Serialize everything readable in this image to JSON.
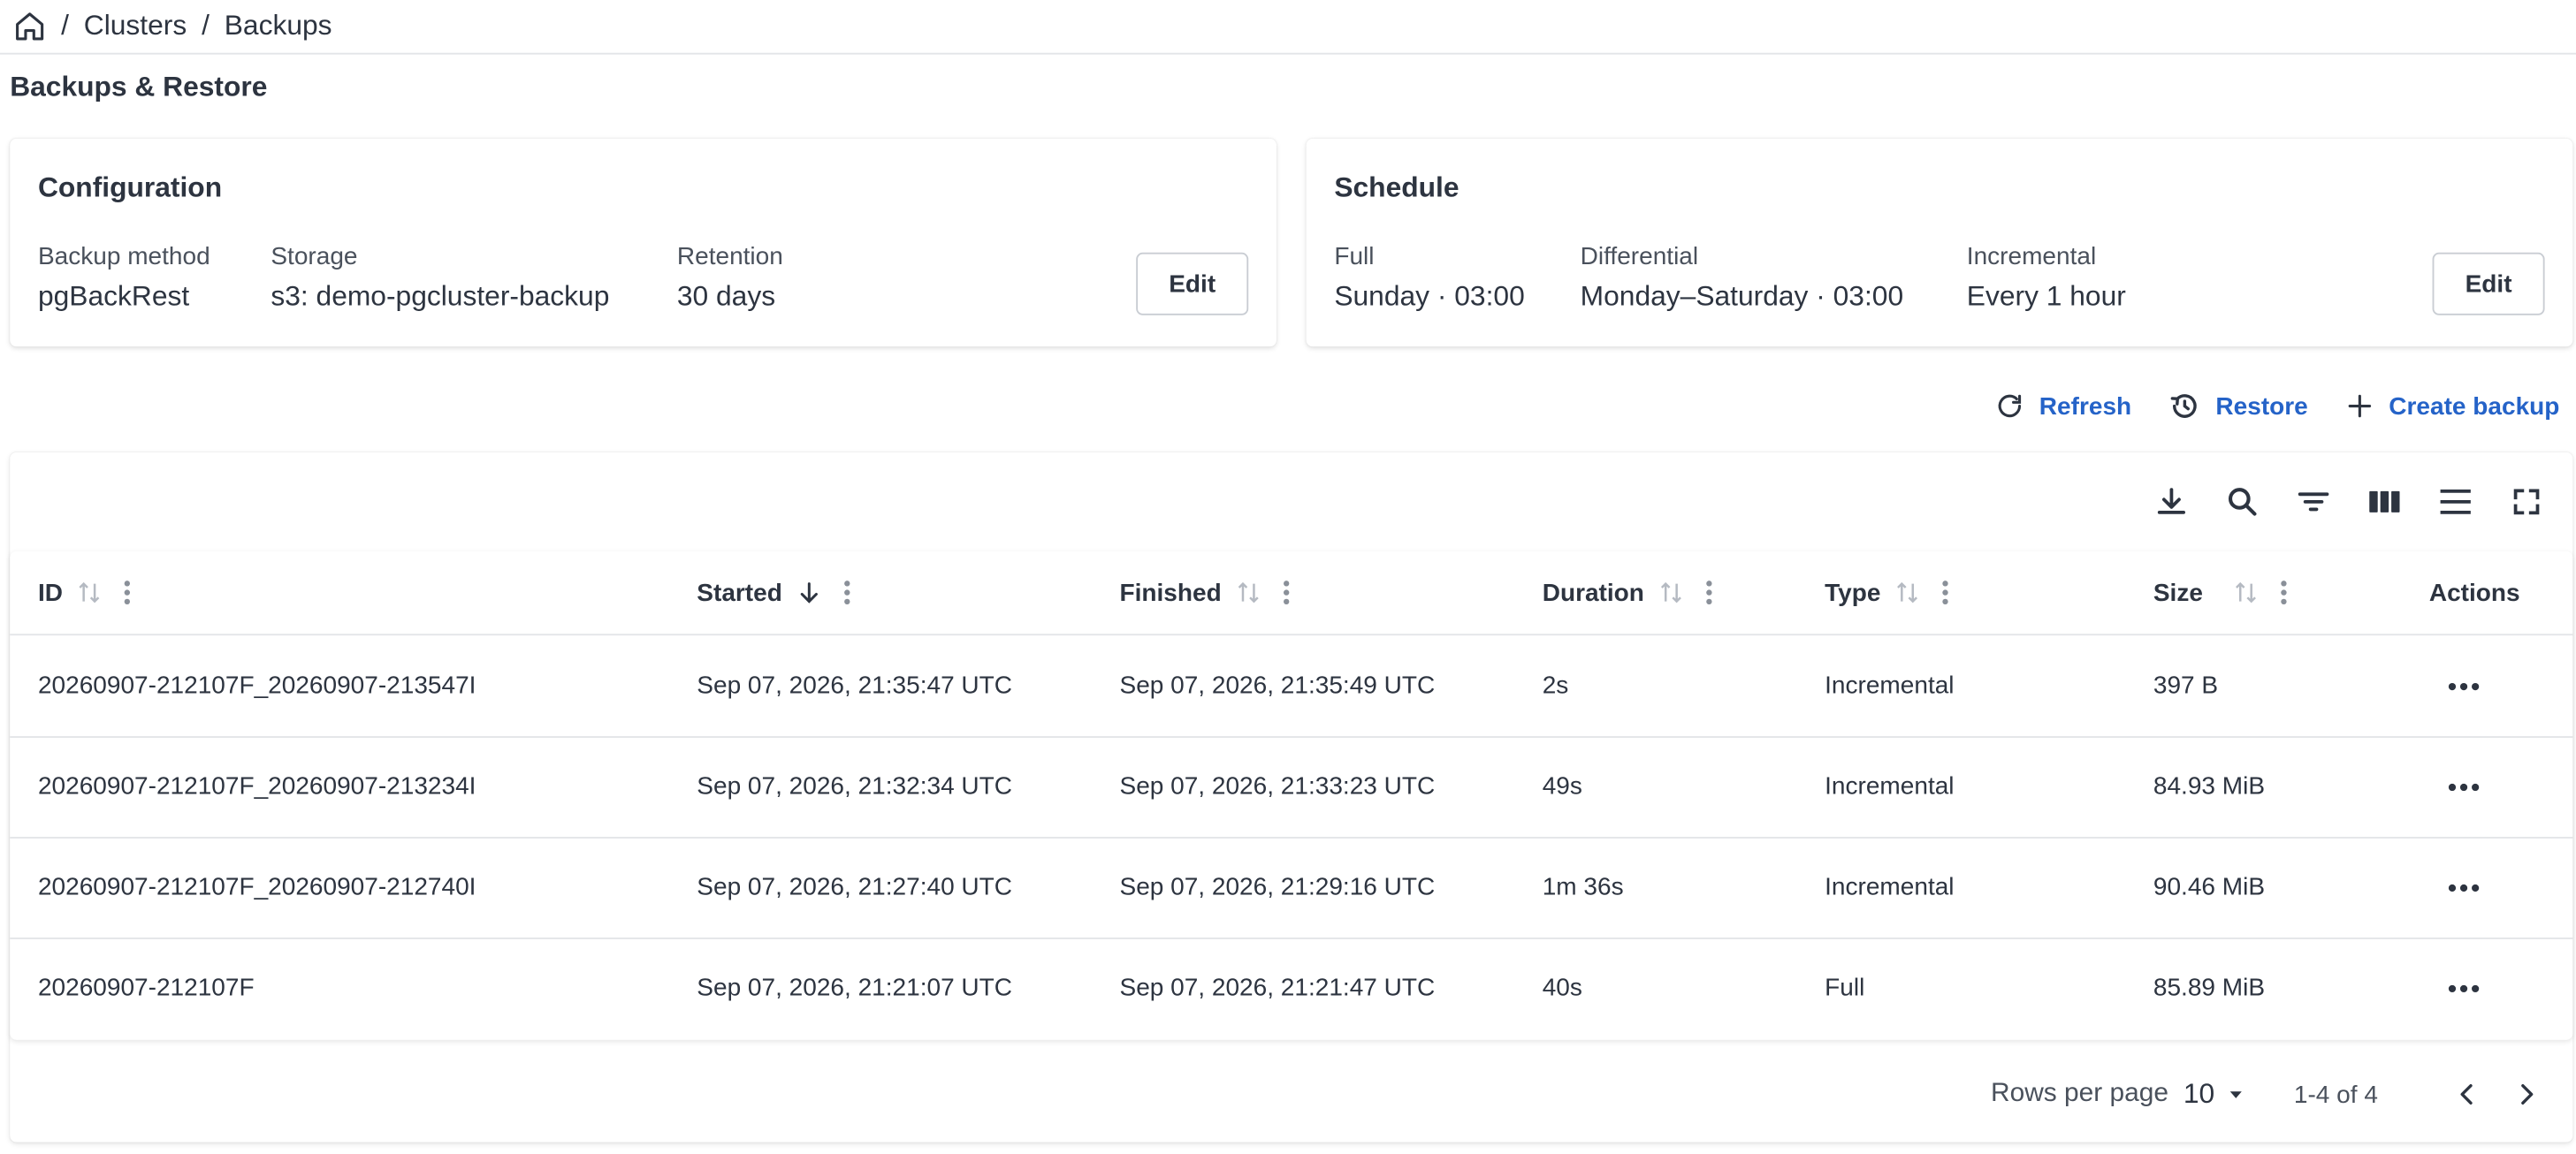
{
  "breadcrumb": {
    "items": [
      "Clusters",
      "Backups"
    ],
    "separator": "/"
  },
  "page": {
    "title": "Backups & Restore"
  },
  "configuration": {
    "title": "Configuration",
    "fields": [
      {
        "label": "Backup method",
        "value": "pgBackRest"
      },
      {
        "label": "Storage",
        "value": "s3: demo-pgcluster-backup"
      },
      {
        "label": "Retention",
        "value": "30 days"
      }
    ],
    "edit_label": "Edit"
  },
  "schedule": {
    "title": "Schedule",
    "fields": [
      {
        "label": "Full",
        "value": "Sunday · 03:00"
      },
      {
        "label": "Differential",
        "value": "Monday–Saturday · 03:00"
      },
      {
        "label": "Incremental",
        "value": "Every 1 hour"
      }
    ],
    "edit_label": "Edit"
  },
  "actions": {
    "refresh": "Refresh",
    "restore": "Restore",
    "create": "Create backup"
  },
  "colors": {
    "accent": "#2563c8",
    "text": "#2d3440",
    "border": "#e3e5e8"
  },
  "table": {
    "columns": [
      "ID",
      "Started",
      "Finished",
      "Duration",
      "Type",
      "Size",
      "Actions"
    ],
    "rows": [
      [
        "20260907-212107F_20260907-213547I",
        "Sep 07, 2026, 21:35:47 UTC",
        "Sep 07, 2026, 21:35:49 UTC",
        "2s",
        "Incremental",
        "397 B"
      ],
      [
        "20260907-212107F_20260907-213234I",
        "Sep 07, 2026, 21:32:34 UTC",
        "Sep 07, 2026, 21:33:23 UTC",
        "49s",
        "Incremental",
        "84.93 MiB"
      ],
      [
        "20260907-212107F_20260907-212740I",
        "Sep 07, 2026, 21:27:40 UTC",
        "Sep 07, 2026, 21:29:16 UTC",
        "1m 36s",
        "Incremental",
        "90.46 MiB"
      ],
      [
        "20260907-212107F",
        "Sep 07, 2026, 21:21:07 UTC",
        "Sep 07, 2026, 21:21:47 UTC",
        "40s",
        "Full",
        "85.89 MiB"
      ]
    ]
  },
  "pagination": {
    "rows_per_page_label": "Rows per page",
    "rows_per_page": "10",
    "range": "1-4 of 4"
  }
}
